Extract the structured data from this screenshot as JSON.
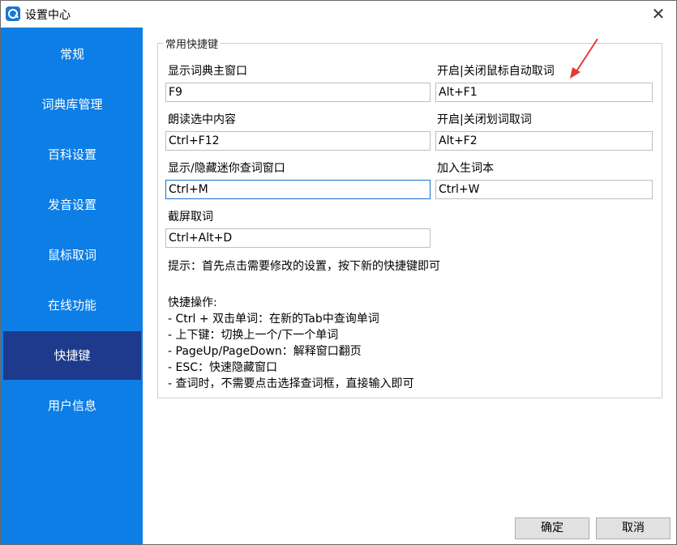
{
  "window": {
    "title": "设置中心"
  },
  "sidebar": {
    "items": [
      {
        "label": "常规"
      },
      {
        "label": "词典库管理"
      },
      {
        "label": "百科设置"
      },
      {
        "label": "发音设置"
      },
      {
        "label": "鼠标取词"
      },
      {
        "label": "在线功能"
      },
      {
        "label": "快捷键"
      },
      {
        "label": "用户信息"
      }
    ],
    "active_index": 6
  },
  "hotkeys": {
    "group_title": "常用快捷键",
    "show_main": {
      "label": "显示词典主窗口",
      "value": "F9"
    },
    "toggle_mouse": {
      "label": "开启|关闭鼠标自动取词",
      "value": "Alt+F1"
    },
    "read_selection": {
      "label": "朗读选中内容",
      "value": "Ctrl+F12"
    },
    "toggle_select": {
      "label": "开启|关闭划词取词",
      "value": "Alt+F2"
    },
    "mini_window": {
      "label": "显示/隐藏迷你查词窗口",
      "value": "Ctrl+M"
    },
    "add_word": {
      "label": "加入生词本",
      "value": "Ctrl+W"
    },
    "screenshot": {
      "label": "截屏取词",
      "value": "Ctrl+Alt+D"
    },
    "hint": "提示：首先点击需要修改的设置，按下新的快捷键即可"
  },
  "quick_ops": {
    "title": "快捷操作:",
    "lines": [
      "- Ctrl + 双击单词：在新的Tab中查询单词",
      "- 上下键：切换上一个/下一个单词",
      "- PageUp/PageDown：解释窗口翻页",
      "- ESC：快速隐藏窗口",
      "- 查词时，不需要点击选择查词框，直接输入即可"
    ]
  },
  "buttons": {
    "ok": "确定",
    "cancel": "取消"
  },
  "colors": {
    "sidebar": "#0c7ee6",
    "active": "#1e3a8c",
    "annotation_arrow": "#e53935"
  }
}
